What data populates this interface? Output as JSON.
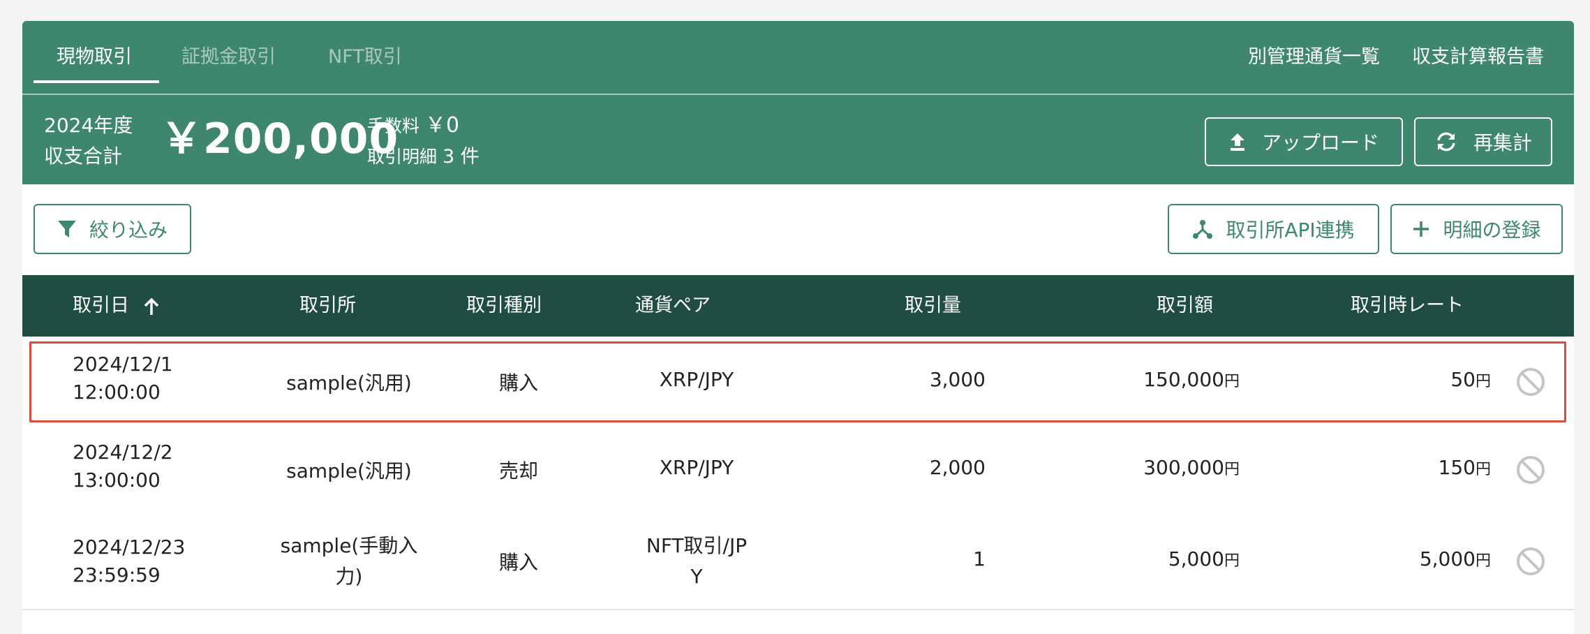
{
  "tabs": [
    {
      "label": "現物取引"
    },
    {
      "label": "証拠金取引"
    },
    {
      "label": "NFT取引"
    }
  ],
  "header_links": {
    "segregated": "別管理通貨一覧",
    "report": "収支計算報告書"
  },
  "summary": {
    "year_line1": "2024年度",
    "year_line2": "収支合計",
    "total": "￥200,000",
    "fee_label": "手数料",
    "fee_value": "￥0",
    "detail_label": "取引明細",
    "detail_value": "3 件"
  },
  "buttons": {
    "upload": "アップロード",
    "recalc": "再集計",
    "filter": "絞り込み",
    "api": "取引所API連携",
    "register": "明細の登録"
  },
  "table": {
    "headers": {
      "date": "取引日",
      "exchange": "取引所",
      "type": "取引種別",
      "pair": "通貨ペア",
      "amount": "取引量",
      "value": "取引額",
      "rate": "取引時レート"
    },
    "rows": [
      {
        "date1": "2024/12/1",
        "date2": "12:00:00",
        "exchange1": "sample(汎用)",
        "exchange2": "",
        "type": "購入",
        "pair1": "XRP/JPY",
        "pair2": "",
        "amount": "3,000",
        "value": "150,000",
        "rate": "50"
      },
      {
        "date1": "2024/12/2",
        "date2": "13:00:00",
        "exchange1": "sample(汎用)",
        "exchange2": "",
        "type": "売却",
        "pair1": "XRP/JPY",
        "pair2": "",
        "amount": "2,000",
        "value": "300,000",
        "rate": "150"
      },
      {
        "date1": "2024/12/23",
        "date2": "23:59:59",
        "exchange1": "sample(手動入",
        "exchange2": "力)",
        "type": "購入",
        "pair1": "NFT取引/JP",
        "pair2": "Y",
        "amount": "1",
        "value": "5,000",
        "rate": "5,000"
      }
    ],
    "yen_unit": "円"
  },
  "colors": {
    "primary": "#3f866e",
    "header_dark": "#1f4d42",
    "highlight": "#e0493a"
  }
}
